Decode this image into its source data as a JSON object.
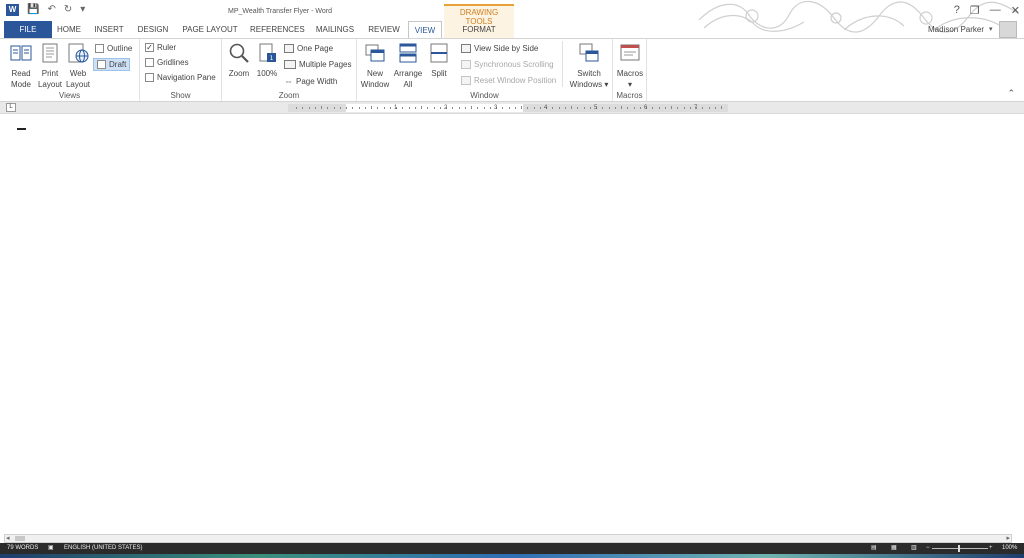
{
  "window": {
    "title": "MP_Wealth Transfer Flyer - Word",
    "user": "Madison Parker"
  },
  "tabs": [
    "FILE",
    "HOME",
    "INSERT",
    "DESIGN",
    "PAGE LAYOUT",
    "REFERENCES",
    "MAILINGS",
    "REVIEW",
    "VIEW"
  ],
  "contextual": {
    "group": "DRAWING TOOLS",
    "tab": "FORMAT"
  },
  "ribbon": {
    "views": {
      "label": "Views",
      "read_mode": [
        "Read",
        "Mode"
      ],
      "print_layout": [
        "Print",
        "Layout"
      ],
      "web_layout": [
        "Web",
        "Layout"
      ],
      "outline": "Outline",
      "draft": "Draft"
    },
    "show": {
      "label": "Show",
      "ruler": "Ruler",
      "ruler_checked": true,
      "gridlines": "Gridlines",
      "gridlines_checked": false,
      "navigation_pane": "Navigation Pane",
      "navigation_pane_checked": false
    },
    "zoom": {
      "label": "Zoom",
      "zoom": "Zoom",
      "hundred": "100%",
      "one_page": "One Page",
      "multiple_pages": "Multiple Pages",
      "page_width": "Page Width"
    },
    "window": {
      "label": "Window",
      "new_window": [
        "New",
        "Window"
      ],
      "arrange_all": [
        "Arrange",
        "All"
      ],
      "split": "Split",
      "view_side_by_side": "View Side by Side",
      "synchronous_scrolling": "Synchronous Scrolling",
      "reset_window_position": "Reset Window Position",
      "switch_windows": [
        "Switch",
        "Windows"
      ]
    },
    "macros": {
      "label": "Macros",
      "button": "Macros"
    }
  },
  "ruler": {
    "numbers": [
      "1",
      "2",
      "3",
      "4",
      "5",
      "6",
      "7"
    ]
  },
  "statusbar": {
    "words": "79 WORDS",
    "language": "ENGLISH (UNITED STATES)",
    "zoom_level": "100%",
    "zoom_minus": "−",
    "zoom_plus": "+"
  },
  "icons": {
    "word_logo": "W",
    "save": "💾",
    "undo": "↶",
    "redo": "↻",
    "customize": "▾",
    "help": "?",
    "restore": "❐",
    "minimize": "—",
    "close": "✕",
    "avatar_dropdown": "▾",
    "collapse": "⌃",
    "macros_dropdown": "▾",
    "switch_dropdown": "▾",
    "scroll_left": "◂",
    "scroll_right": "▸",
    "ruler_tab": "L"
  }
}
